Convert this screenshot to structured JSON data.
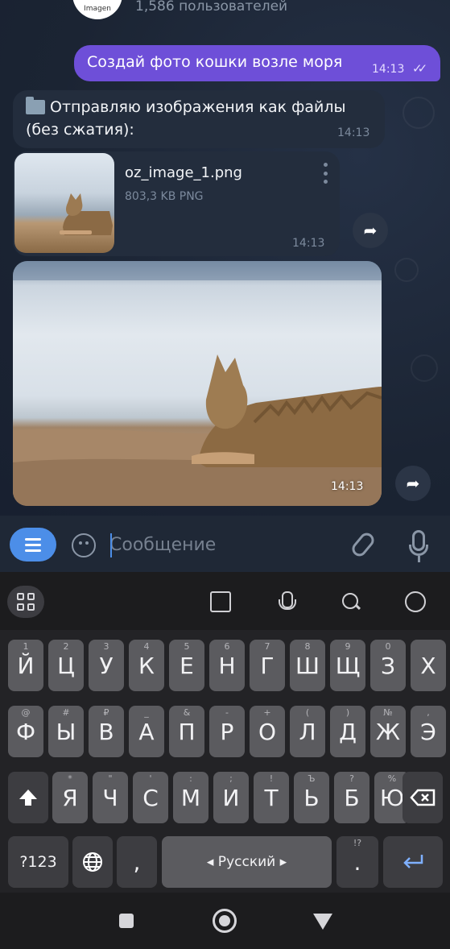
{
  "header": {
    "avatar_text": "Imagen",
    "subtitle": "1,586 пользователей"
  },
  "messages": {
    "outgoing": {
      "text": "Создай фото кошки возле моря",
      "time": "14:13",
      "status_icon": "double-check-icon"
    },
    "incoming_text": {
      "line1": "Отправляю изображения как файлы",
      "line2": "(без сжатия):",
      "time": "14:13",
      "icon": "folder-icon"
    },
    "file": {
      "name": "oz_image_1.png",
      "meta": "803,3 KB PNG",
      "time": "14:13"
    },
    "photo": {
      "time": "14:13"
    }
  },
  "composer": {
    "placeholder": "Сообщение"
  },
  "keyboard": {
    "row1": [
      {
        "label": "Й",
        "hint": "1"
      },
      {
        "label": "Ц",
        "hint": "2"
      },
      {
        "label": "У",
        "hint": "3"
      },
      {
        "label": "К",
        "hint": "4"
      },
      {
        "label": "Е",
        "hint": "5"
      },
      {
        "label": "Н",
        "hint": "6"
      },
      {
        "label": "Г",
        "hint": "7"
      },
      {
        "label": "Ш",
        "hint": "8"
      },
      {
        "label": "Щ",
        "hint": "9"
      },
      {
        "label": "З",
        "hint": "0"
      },
      {
        "label": "Х",
        "hint": ""
      }
    ],
    "row2": [
      {
        "label": "Ф",
        "hint": "@"
      },
      {
        "label": "Ы",
        "hint": "#"
      },
      {
        "label": "В",
        "hint": "₽"
      },
      {
        "label": "А",
        "hint": "_"
      },
      {
        "label": "П",
        "hint": "&"
      },
      {
        "label": "Р",
        "hint": "-"
      },
      {
        "label": "О",
        "hint": "+"
      },
      {
        "label": "Л",
        "hint": "("
      },
      {
        "label": "Д",
        "hint": ")"
      },
      {
        "label": "Ж",
        "hint": "№"
      },
      {
        "label": "Э",
        "hint": ","
      }
    ],
    "row3": [
      {
        "label": "Я",
        "hint": "*"
      },
      {
        "label": "Ч",
        "hint": "\""
      },
      {
        "label": "С",
        "hint": "'"
      },
      {
        "label": "М",
        "hint": ":"
      },
      {
        "label": "И",
        "hint": ";"
      },
      {
        "label": "Т",
        "hint": "!"
      },
      {
        "label": "Ь",
        "hint": "Ъ"
      },
      {
        "label": "Б",
        "hint": "?"
      },
      {
        "label": "Ю",
        "hint": "%"
      }
    ],
    "symbols_label": "?123",
    "comma_label": ",",
    "space_label": "◂ Русский ▸",
    "period_label": ".",
    "period_hint": "!?",
    "shift_icon": "shift-icon",
    "backspace_icon": "backspace-icon",
    "enter_icon": "enter-icon",
    "globe_icon": "globe-icon"
  },
  "colors": {
    "outgoing_bubble": "#6e4fd8",
    "incoming_bubble": "#232d3d",
    "accent": "#4c8ee8",
    "key": "#5b5b5f"
  }
}
